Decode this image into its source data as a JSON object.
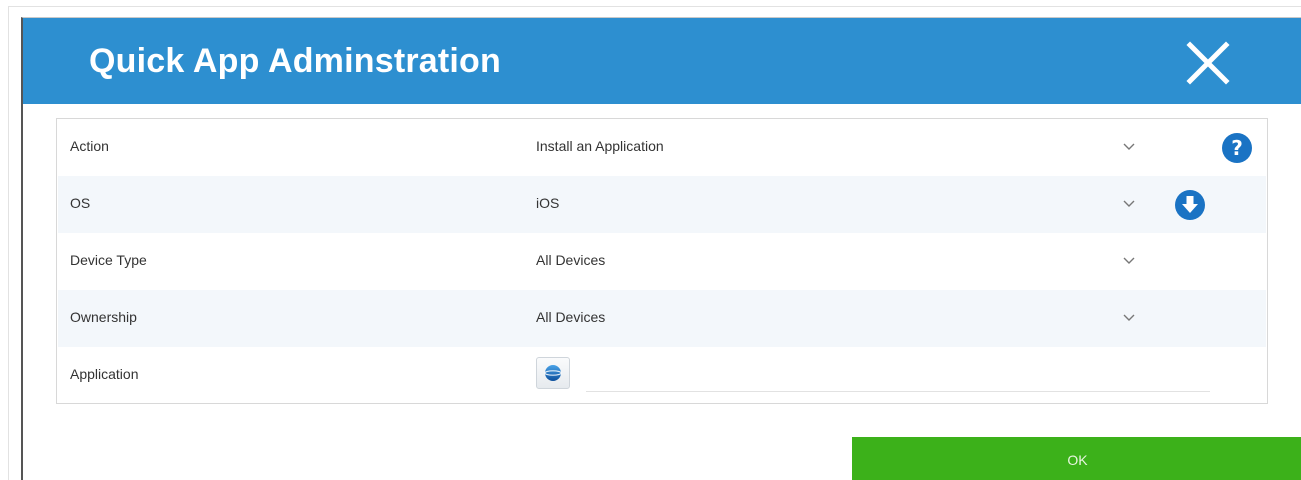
{
  "dialog": {
    "title": "Quick App Adminstration",
    "close_icon": "close-icon",
    "header_color": "#2d8fd0"
  },
  "form": {
    "rows": [
      {
        "label": "Action",
        "value": "Install an Application",
        "control": "dropdown",
        "side_icon": "help-icon"
      },
      {
        "label": "OS",
        "value": "iOS",
        "control": "dropdown",
        "side_icon": "download-icon"
      },
      {
        "label": "Device Type",
        "value": "All Devices",
        "control": "dropdown"
      },
      {
        "label": "Ownership",
        "value": "All Devices",
        "control": "dropdown"
      },
      {
        "label": "Application",
        "value": "",
        "control": "app-picker",
        "picker_icon": "globe-icon"
      }
    ]
  },
  "footer": {
    "ok_label": "OK",
    "ok_color": "#3cb11a"
  },
  "colors": {
    "icon_blue": "#1a73c4",
    "row_alt": "#f3f7fb"
  }
}
